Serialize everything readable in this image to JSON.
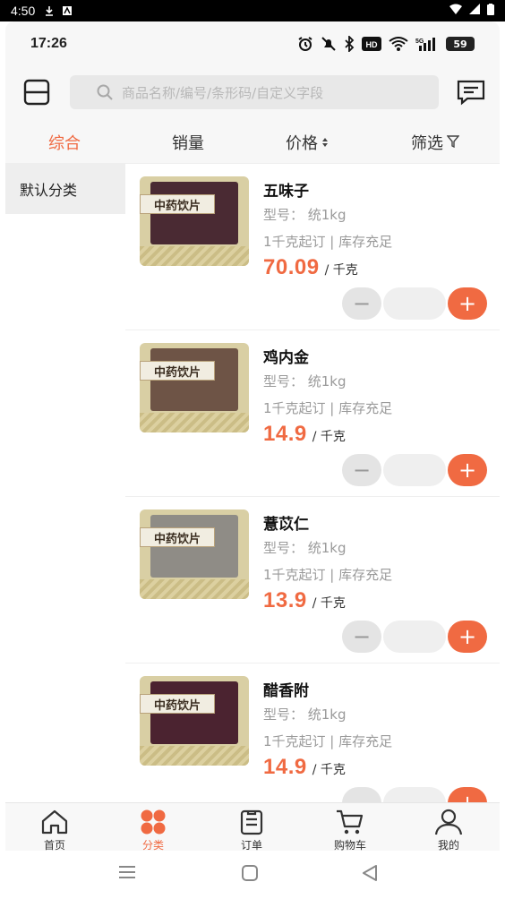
{
  "system_bar": {
    "time": "4:50"
  },
  "status_bar": {
    "time": "17:26",
    "battery": "59"
  },
  "header": {
    "search_placeholder": "商品名称/编号/条形码/自定义字段",
    "scan_icon": "scan-icon",
    "message_icon": "message-icon"
  },
  "sort_tabs": [
    {
      "label": "综合",
      "active": true
    },
    {
      "label": "销量",
      "active": false
    },
    {
      "label": "价格",
      "active": false
    },
    {
      "label": "筛选",
      "active": false
    }
  ],
  "categories": [
    {
      "label": "默认分类",
      "selected": true
    }
  ],
  "products": [
    {
      "name": "五味子",
      "model": "型号：  统1kg",
      "moq_stock": "1千克起订 | 库存充足",
      "price": "70.09",
      "unit": "/ 千克",
      "thumb_label": "中药饮片",
      "bag_color": "#4a2a33"
    },
    {
      "name": "鸡内金",
      "model": "型号：  统1kg",
      "moq_stock": "1千克起订 | 库存充足",
      "price": "14.9",
      "unit": "/ 千克",
      "thumb_label": "中药饮片",
      "bag_color": "#6e5446"
    },
    {
      "name": "薏苡仁",
      "model": "型号：  统1kg",
      "moq_stock": "1千克起订 | 库存充足",
      "price": "13.9",
      "unit": "/ 千克",
      "thumb_label": "中药饮片",
      "bag_color": "#8f8c86"
    },
    {
      "name": "醋香附",
      "model": "型号：  统1kg",
      "moq_stock": "1千克起订 | 库存充足",
      "price": "14.9",
      "unit": "/ 千克",
      "thumb_label": "中药饮片",
      "bag_color": "#4b2330"
    }
  ],
  "tabbar": [
    {
      "label": "首页",
      "icon": "home-icon",
      "active": false
    },
    {
      "label": "分类",
      "icon": "category-icon",
      "active": true
    },
    {
      "label": "订单",
      "icon": "order-icon",
      "active": false
    },
    {
      "label": "购物车",
      "icon": "cart-icon",
      "active": false
    },
    {
      "label": "我的",
      "icon": "profile-icon",
      "active": false
    }
  ],
  "colors": {
    "accent": "#f06a42",
    "muted": "#9a9a9a"
  }
}
